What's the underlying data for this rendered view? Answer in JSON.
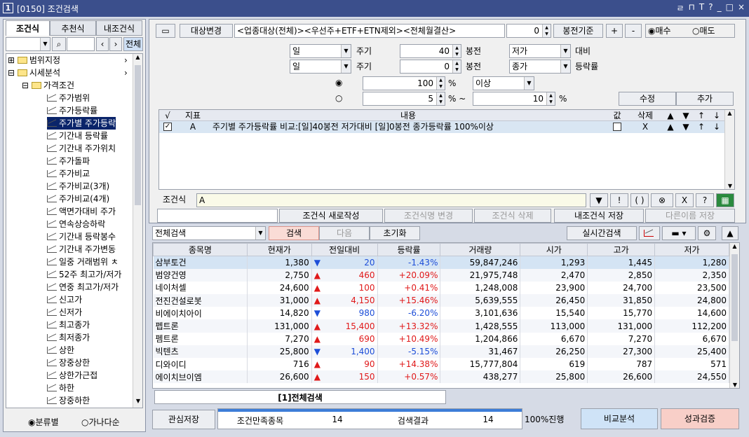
{
  "window": {
    "number": "1",
    "title": "[0150] 조건검색",
    "controls": [
      "ㄹ",
      "⊓",
      "T",
      "?",
      "_",
      "□",
      "×"
    ]
  },
  "left": {
    "tabs": [
      "조건식",
      "추천식",
      "내조건식"
    ],
    "filter_all": "전체",
    "tree": {
      "root1": "범위지정",
      "root2": "시세분석",
      "group": "가격조건",
      "items": [
        "주가범위",
        "주가등락률",
        "주가별 주가등락",
        "기간내 등락률",
        "기간내 주가위치",
        "주가돌파",
        "주가비교",
        "주가비교(3개)",
        "주가비교(4개)",
        "액면가대비 주가",
        "연속상승하락",
        "기간내 등락봉수",
        "기간내 주가변동",
        "일중 거래범위 ㅊ",
        "52주 최고가/저가",
        "연중 최고가/저가",
        "신고가",
        "신저가",
        "최고종가",
        "최저종가",
        "상한",
        "장중상한",
        "상한가근접",
        "하한",
        "장중하한"
      ]
    },
    "radio": {
      "option1": "분류별",
      "option2": "가나다순"
    }
  },
  "top": {
    "target_btn": "대상변경",
    "target_text": "<업종대상(전체)><우선주+ETF+ETN제외><전체월결산>",
    "bong_value": "0",
    "bong_btn": "봉전기준",
    "plus": "+",
    "minus": "-",
    "buy": "매수",
    "sell": "매도"
  },
  "cond": {
    "period1": "일",
    "period2": "일",
    "lbl_period": "주기",
    "val1": "40",
    "val2": "0",
    "lbl_bong": "봉전",
    "price1": "저가",
    "price2": "종가",
    "lbl_vs": "대비",
    "lbl_rate": "등락률",
    "pct1": "100",
    "pct_unit": "%",
    "above": "이상",
    "pct2": "5",
    "pct_range": "% ~",
    "pct3": "10",
    "pct_unit2": "%",
    "edit_btn": "수정",
    "add_btn": "추가"
  },
  "grid": {
    "headers": [
      "√",
      "지표",
      "내용",
      "값",
      "삭제",
      "▲",
      "▼",
      "↑",
      "↓"
    ],
    "row": {
      "check": "✓",
      "letter": "A",
      "content": "주기별 주가등락률 비교:[일]40봉전 저가대비 [일]0봉전 종가등락률 100%이상",
      "del": "X"
    }
  },
  "formula": {
    "label": "조건식",
    "value": "A",
    "tools": [
      "▼",
      "!",
      "( )",
      "⊗",
      "X",
      "?"
    ]
  },
  "actions": {
    "new": "조건식 새로작성",
    "rename": "조건식명 변경",
    "delete": "조건식 삭제",
    "save": "내조건식 저장",
    "saveas": "다른이름 저장"
  },
  "search": {
    "scope": "전체검색",
    "search_btn": "검색",
    "next_btn": "다음",
    "reset_btn": "초기화",
    "realtime_btn": "실시간검색"
  },
  "results": {
    "headers": [
      "종목명",
      "현재가",
      "전일대비",
      "등락률",
      "거래량",
      "시가",
      "고가",
      "저가"
    ],
    "rows": [
      {
        "name": "삼부토건",
        "price": "1,380",
        "dir": "down",
        "chg": "20",
        "rate": "-1.43%",
        "vol": "59,847,246",
        "open": "1,293",
        "high": "1,445",
        "low": "1,280"
      },
      {
        "name": "범양건영",
        "price": "2,750",
        "dir": "up",
        "chg": "460",
        "rate": "+20.09%",
        "vol": "21,975,748",
        "open": "2,470",
        "high": "2,850",
        "low": "2,350"
      },
      {
        "name": "네이처셀",
        "price": "24,600",
        "dir": "up",
        "chg": "100",
        "rate": "+0.41%",
        "vol": "1,248,008",
        "open": "23,900",
        "high": "24,700",
        "low": "23,500"
      },
      {
        "name": "전진건설로봇",
        "price": "31,000",
        "dir": "up",
        "chg": "4,150",
        "rate": "+15.46%",
        "vol": "5,639,555",
        "open": "26,450",
        "high": "31,850",
        "low": "24,800"
      },
      {
        "name": "비에이치아이",
        "price": "14,820",
        "dir": "down",
        "chg": "980",
        "rate": "-6.20%",
        "vol": "3,101,636",
        "open": "15,540",
        "high": "15,770",
        "low": "14,600"
      },
      {
        "name": "펩트론",
        "price": "131,000",
        "dir": "up",
        "chg": "15,400",
        "rate": "+13.32%",
        "vol": "1,428,555",
        "open": "113,000",
        "high": "131,000",
        "low": "112,200"
      },
      {
        "name": "펨트론",
        "price": "7,270",
        "dir": "up",
        "chg": "690",
        "rate": "+10.49%",
        "vol": "1,204,866",
        "open": "6,670",
        "high": "7,270",
        "low": "6,670"
      },
      {
        "name": "빅텐츠",
        "price": "25,800",
        "dir": "down",
        "chg": "1,400",
        "rate": "-5.15%",
        "vol": "31,467",
        "open": "26,250",
        "high": "27,300",
        "low": "25,400"
      },
      {
        "name": "디와이디",
        "price": "716",
        "dir": "up",
        "chg": "90",
        "rate": "+14.38%",
        "vol": "15,777,804",
        "open": "619",
        "high": "787",
        "low": "571"
      },
      {
        "name": "에이치브이엠",
        "price": "26,600",
        "dir": "up",
        "chg": "150",
        "rate": "+0.57%",
        "vol": "438,277",
        "open": "25,800",
        "high": "26,600",
        "low": "24,550"
      }
    ]
  },
  "bottom_tab": "[1]전체검색",
  "status": {
    "save_btn": "관심저장",
    "match_label": "조건만족종목",
    "match_count": "14",
    "result_label": "검색결과",
    "result_count": "14",
    "progress_text": "100%진행",
    "progress": 1.0,
    "compare_btn": "비교분석",
    "perf_btn": "성과검증"
  },
  "colors": {
    "up": "#e0191a",
    "down": "#1d4ed8",
    "title": "#3b4f8c"
  }
}
